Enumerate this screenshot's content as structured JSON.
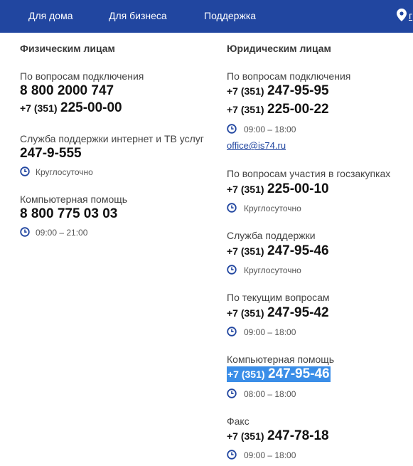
{
  "nav": {
    "items": [
      "Для дома",
      "Для бизнеса",
      "Поддержка"
    ],
    "cut_text": "г",
    "accent": "#2146a0"
  },
  "individuals": {
    "heading": "Физическим лицам",
    "connection": {
      "label": "По вопросам подключения",
      "phone1": "8 800 2000 747",
      "phone2_prefix": "+7 (351)",
      "phone2_number": "225-00-00"
    },
    "support": {
      "label": "Служба поддержки интернет и ТВ услуг",
      "phone": "247-9-555",
      "hours": "Круглосуточно"
    },
    "computer_help": {
      "label": "Компьютерная помощь",
      "phone": "8 800 775 03 03",
      "hours": "09:00 – 21:00"
    }
  },
  "business": {
    "heading": "Юридическим лицам",
    "connection": {
      "label": "По вопросам подключения",
      "phone1_prefix": "+7 (351)",
      "phone1_number": "247-95-95",
      "phone2_prefix": "+7 (351)",
      "phone2_number": "225-00-22",
      "hours": "09:00 – 18:00",
      "email": "office@is74.ru"
    },
    "tenders": {
      "label": "По вопросам участия в госзакупках",
      "prefix": "+7 (351)",
      "number": "225-00-10",
      "hours": "Круглосуточно"
    },
    "support": {
      "label": "Служба поддержки",
      "prefix": "+7 (351)",
      "number": "247-95-46",
      "hours": "Круглосуточно"
    },
    "current": {
      "label": "По текущим вопросам",
      "prefix": "+7 (351)",
      "number": "247-95-42",
      "hours": "09:00 – 18:00"
    },
    "computer_help": {
      "label": "Компьютерная помощь",
      "prefix": "+7 (351)",
      "number": "247-95-46",
      "hours": "08:00 – 18:00"
    },
    "fax": {
      "label": "Факс",
      "prefix": "+7 (351)",
      "number": "247-78-18",
      "hours": "09:00 – 18:00"
    }
  },
  "icons": {
    "clock": "clock-icon",
    "location": "location-pin-icon"
  }
}
